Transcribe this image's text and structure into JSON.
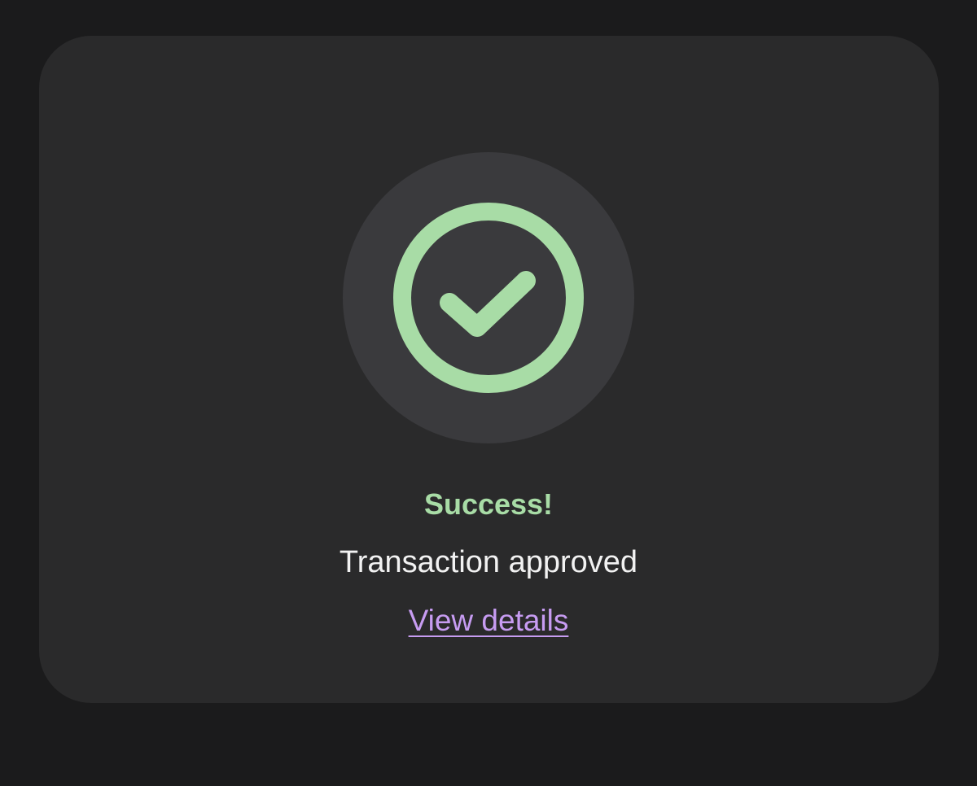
{
  "colors": {
    "page_background": "#1b1b1c",
    "card_background": "#2a2a2b",
    "icon_background": "#3a3a3d",
    "success": "#a8dca6",
    "text_primary": "#f2f2f2",
    "link": "#c79cf2"
  },
  "status_card": {
    "icon": "check-circle-icon",
    "title": "Success!",
    "message": "Transaction approved",
    "link_label": "View details"
  }
}
